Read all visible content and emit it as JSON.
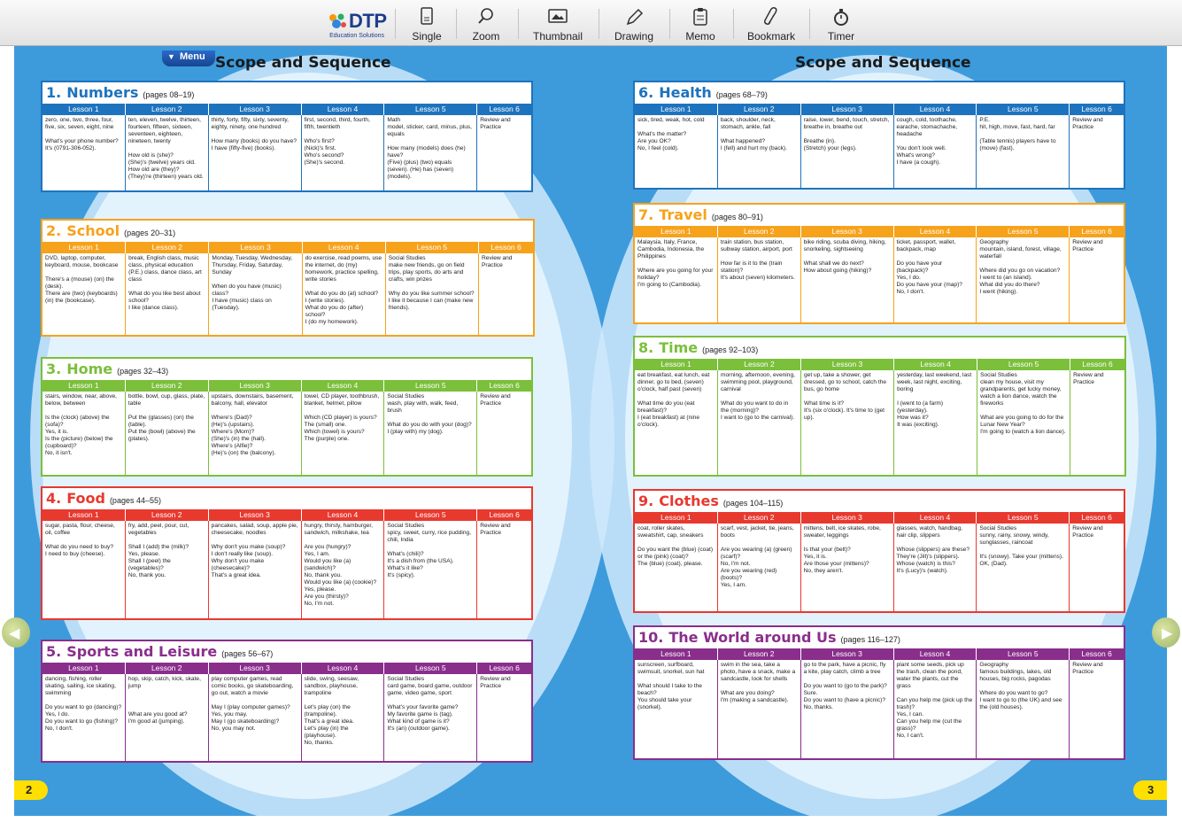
{
  "toolbar": {
    "logo": {
      "brand": "DTP",
      "sub": "Education Solutions"
    },
    "buttons": [
      {
        "id": "single",
        "label": "Single",
        "icon": "single-page-icon"
      },
      {
        "id": "zoom",
        "label": "Zoom",
        "icon": "magnifier-icon"
      },
      {
        "id": "thumbnail",
        "label": "Thumbnail",
        "icon": "thumbnail-icon"
      },
      {
        "id": "drawing",
        "label": "Drawing",
        "icon": "pencil-icon"
      },
      {
        "id": "memo",
        "label": "Memo",
        "icon": "memo-icon"
      },
      {
        "id": "bookmark",
        "label": "Bookmark",
        "icon": "paperclip-icon"
      },
      {
        "id": "timer",
        "label": "Timer",
        "icon": "stopwatch-icon"
      }
    ]
  },
  "menu_label": "Menu",
  "left_title": "Scope and Sequence",
  "right_title": "Scope and Sequence",
  "left_page_number": "2",
  "right_page_number": "3",
  "colors": {
    "blue": "#1e73be",
    "orange": "#f7a21b",
    "green": "#7bbf3b",
    "red": "#e8392f",
    "purple": "#8a2e8c"
  },
  "units": [
    {
      "num": "1.",
      "name": "Numbers",
      "pages": "(pages 08–19)",
      "color": "#1e73be",
      "headers": [
        "Lesson 1",
        "Lesson 2",
        "Lesson 3",
        "Lesson 4",
        "Lesson 5",
        "Lesson 6"
      ],
      "cells": [
        "zero, one, two, three, four, five, six, seven, eight, nine\n\nWhat's your phone number?\nIt's (0791-306-052).",
        "ten, eleven, twelve, thirteen, fourteen, fifteen, sixteen, seventeen, eighteen, nineteen, twenty\n\nHow old is (she)?\n(She)'s (twelve) years old.\nHow old are (they)?\n(They)'re (thirteen) years old.",
        "thirty, forty, fifty, sixty, seventy, eighty, ninety, one hundred\n\nHow many (books) do you have?\nI have (fifty-five) (books).",
        "first, second, third, fourth, fifth, twentieth\n\nWho's first?\n(Nick)'s first.\nWho's second?\n(She)'s second.",
        "Math\nmodel, sticker, card, minus, plus, equals\n\nHow many (models) does (he) have?\n(Five) (plus) (two) equals (seven). (He) has (seven) (models).",
        "Review and Practice"
      ]
    },
    {
      "num": "2.",
      "name": "School",
      "pages": "(pages 20–31)",
      "color": "#f7a21b",
      "headers": [
        "Lesson 1",
        "Lesson 2",
        "Lesson 3",
        "Lesson 4",
        "Lesson 5",
        "Lesson 6"
      ],
      "cells": [
        "DVD, laptop, computer, keyboard, mouse, bookcase\n\nThere's a (mouse) (on) the (desk).\nThere are (two) (keyboards) (in) the (bookcase).",
        "break, English class, music class, physical education (P.E.) class, dance class, art class\n\nWhat do you like best about school?\nI like (dance class).",
        "Monday, Tuesday, Wednesday, Thursday, Friday, Saturday, Sunday\n\nWhen do you have (music) class?\nI have (music) class on (Tuesday).",
        "do exercise, read poems, use the internet, do (my) homework, practice spelling, write stories\n\nWhat do you do (at) school?\nI (write stories).\nWhat do you do (after) school?\nI (do my homework).",
        "Social Studies\nmake new friends, go on field trips, play sports, do arts and crafts, win prizes\n\nWhy do you like summer school?\nI like it because I can (make new friends).",
        "Review and Practice"
      ]
    },
    {
      "num": "3.",
      "name": "Home",
      "pages": "(pages 32–43)",
      "color": "#7bbf3b",
      "headers": [
        "Lesson 1",
        "Lesson 2",
        "Lesson 3",
        "Lesson 4",
        "Lesson 5",
        "Lesson 6"
      ],
      "cells": [
        "stairs, window, near, above, below, between\n\nIs the (clock) (above) the (sofa)?\nYes, it is.\nIs the (picture) (below) the (cupboard)?\nNo, it isn't.",
        "bottle, bowl, cup, glass, plate, table\n\nPut the (glasses) (on) the (table).\nPut the (bowl) (above) the (plates).",
        "upstairs, downstairs, basement, balcony, hall, elevator\n\nWhere's (Dad)?\n(He)'s (upstairs).\nWhere's (Mom)?\n(She)'s (in) the (hall).\nWhere's (Alfie)?\n(He)'s (on) the (balcony).",
        "towel, CD player, toothbrush, blanket, helmet, pillow\n\nWhich (CD player) is yours?\nThe (small) one.\nWhich (towel) is yours?\nThe (purple) one.",
        "Social Studies\nwash, play with, walk, feed, brush\n\nWhat do you do with your (dog)?\nI (play with) my (dog).",
        "Review and Practice"
      ]
    },
    {
      "num": "4.",
      "name": "Food",
      "pages": "(pages 44–55)",
      "color": "#e8392f",
      "headers": [
        "Lesson 1",
        "Lesson 2",
        "Lesson 3",
        "Lesson 4",
        "Lesson 5",
        "Lesson 6"
      ],
      "cells": [
        "sugar, pasta, flour, cheese, oil, coffee\n\nWhat do you need to buy?\nI need to buy (cheese).",
        "fry, add, peel, pour, cut, vegetables\n\nShall I (add) the (milk)?\nYes, please.\nShall I (peel) the (vegetables)?\nNo, thank you.",
        "pancakes, salad, soup, apple pie, cheesecake, noodles\n\nWhy don't you make (soup)?\nI don't really like (soup).\nWhy don't you make (cheesecake)?\nThat's a great idea.",
        "hungry, thirsty, hamburger, sandwich, milkshake, tea\n\nAre you (hungry)?\nYes, I am.\nWould you like (a) (sandwich)?\nNo, thank you.\nWould you like (a) (cookie)?\nYes, please.\nAre you (thirsty)?\nNo, I'm not.",
        "Social Studies\nspicy, sweet, curry, rice pudding, chili, India\n\nWhat's (chili)?\nIt's a dish from (the USA).\nWhat's it like?\nIt's (spicy).",
        "Review and Practice"
      ]
    },
    {
      "num": "5.",
      "name": "Sports and Leisure",
      "pages": "(pages 56–67)",
      "color": "#8a2e8c",
      "headers": [
        "Lesson 1",
        "Lesson 2",
        "Lesson 3",
        "Lesson 4",
        "Lesson 5",
        "Lesson 6"
      ],
      "cells": [
        "dancing, fishing, roller skating, sailing, ice skating, swimming\n\nDo you want to go (dancing)?\nYes, I do.\nDo you want to go (fishing)?\nNo, I don't.",
        "hop, skip, catch, kick, skate, jump\n\n\n\nWhat are you good at?\nI'm good at (jumping).",
        "play computer games, read comic books, go skateboarding, go out, watch a movie\n\nMay I (play computer games)?\nYes, you may.\nMay I (go skateboarding)?\nNo, you may not.",
        "slide, swing, seesaw, sandbox, playhouse, trampoline\n\nLet's play (on) the (trampoline).\nThat's a great idea.\nLet's play (in) the (playhouse).\nNo, thanks.",
        "Social Studies\ncard game, board game, outdoor game, video game, sport\n\nWhat's your favorite game?\nMy favorite game is (tag).\nWhat kind of game is it?\nIt's (an) (outdoor game).",
        "Review and Practice"
      ]
    },
    {
      "num": "6.",
      "name": "Health",
      "pages": "(pages 68–79)",
      "color": "#1e73be",
      "headers": [
        "Lesson 1",
        "Lesson 2",
        "Lesson 3",
        "Lesson 4",
        "Lesson 5",
        "Lesson 6"
      ],
      "cells": [
        "sick, tired, weak, hot, cold\n\nWhat's the matter?\nAre you OK?\nNo, I feel (cold).",
        "back, shoulder, neck, stomach, ankle, fall\n\nWhat happened?\nI (fell) and hurt my (back).",
        "raise, lower, bend, touch, stretch, breathe in, breathe out\n\nBreathe (in).\n(Stretch) your (legs).",
        "cough, cold, toothache, earache, stomachache, headache\n\nYou don't look well.\nWhat's wrong?\nI have (a cough).",
        "P.E.\nhit, high, move, fast, hard, far\n\n(Table tennis) players have to (move) (fast).",
        "Review and Practice"
      ]
    },
    {
      "num": "7.",
      "name": "Travel",
      "pages": "(pages 80–91)",
      "color": "#f7a21b",
      "headers": [
        "Lesson 1",
        "Lesson 2",
        "Lesson 3",
        "Lesson 4",
        "Lesson 5",
        "Lesson 6"
      ],
      "cells": [
        "Malaysia, Italy, France, Cambodia, Indonesia, the Philippines\n\nWhere are you going for your holiday?\nI'm going to (Cambodia).",
        "train station, bus station, subway station, airport, port\n\nHow far is it to the (train station)?\nIt's about (seven) kilometers.",
        "bike riding, scuba diving, hiking, snorkeling, sightseeing\n\nWhat shall we do next?\nHow about going (hiking)?",
        "ticket, passport, wallet, backpack, map\n\nDo you have your (backpack)?\nYes, I do.\nDo you have your (map)?\nNo, I don't.",
        "Geography\nmountain, island, forest, village, waterfall\n\nWhere did you go on vacation?\nI went to (an island).\nWhat did you do there?\nI went (hiking).",
        "Review and Practice"
      ]
    },
    {
      "num": "8.",
      "name": "Time",
      "pages": "(pages 92–103)",
      "color": "#7bbf3b",
      "headers": [
        "Lesson 1",
        "Lesson 2",
        "Lesson 3",
        "Lesson 4",
        "Lesson 5",
        "Lesson 6"
      ],
      "cells": [
        "eat breakfast, eat lunch, eat dinner, go to bed, (seven) o'clock, half past (seven)\n\nWhat time do you (eat breakfast)?\nI (eat breakfast) at (nine o'clock).",
        "morning, afternoon, evening, swimming pool, playground, carnival\n\nWhat do you want to do in the (morning)?\nI want to (go to the carnival).",
        "get up, take a shower, get dressed, go to school, catch the bus, go home\n\nWhat time is it?\nIt's (six o'clock). It's time to (get up).",
        "yesterday, last weekend, last week, last night, exciting, boring\n\nI (went to (a farm) (yesterday).\nHow was it?\nIt was (exciting).",
        "Social Studies\nclean my house, visit my grandparents, get lucky money, watch a lion dance, watch the fireworks\n\nWhat are you going to do for the Lunar New Year?\nI'm going to (watch a lion dance).",
        "Review and Practice"
      ]
    },
    {
      "num": "9.",
      "name": "Clothes",
      "pages": "(pages 104–115)",
      "color": "#e8392f",
      "headers": [
        "Lesson 1",
        "Lesson 2",
        "Lesson 3",
        "Lesson 4",
        "Lesson 5",
        "Lesson 6"
      ],
      "cells": [
        "coat, roller skates, sweatshirt, cap, sneakers\n\nDo you want the (blue) (coat) or the (pink) (coat)?\nThe (blue) (coat), please.",
        "scarf, vest, jacket, tie, jeans, boots\n\nAre you wearing (a) (green) (scarf)?\nNo, I'm not.\nAre you wearing (red) (boots)?\nYes, I am.",
        "mittens, belt, ice skates, robe, sweater, leggings\n\nIs that your (belt)?\nYes, it is.\nAre those your (mittens)?\nNo, they aren't.",
        "glasses, watch, handbag, hair clip, slippers\n\nWhose (slippers) are these?\nThey're (Jill)'s (slippers).\nWhose (watch) is this?\nIt's (Lucy)'s (watch).",
        "Social Studies\nsunny, rainy, snowy, windy, sunglasses, raincoat\n\nIt's (snowy). Take your (mittens).\nOK, (Dad).",
        "Review and Practice"
      ]
    },
    {
      "num": "10.",
      "name": "The World around Us",
      "pages": "(pages 116–127)",
      "color": "#8a2e8c",
      "headers": [
        "Lesson 1",
        "Lesson 2",
        "Lesson 3",
        "Lesson 4",
        "Lesson 5",
        "Lesson 6"
      ],
      "cells": [
        "sunscreen, surfboard, swimsuit, snorkel, sun hat\n\nWhat should I take to the beach?\nYou should take your (snorkel).",
        "swim in the sea, take a photo, have a snack, make a sandcastle, look for shells\n\nWhat are you doing?\nI'm (making a sandcastle).",
        "go to the park, have a picnic, fly a kite, play catch, climb a tree\n\nDo you want to (go to the park)?\nSure.\nDo you want to (have a picnic)?\nNo, thanks.",
        "plant some seeds, pick up the trash, clean the pond, water the plants, cut the grass\n\nCan you help me (pick up the trash)?\nYes, I can.\nCan you help me (cut the grass)?\nNo, I can't.",
        "Geography\nfamous buildings, lakes, old houses, big rocks, pagodas\n\nWhere do you want to go?\nI want to go to (the UK) and see the (old houses).",
        "Review and Practice"
      ]
    }
  ]
}
